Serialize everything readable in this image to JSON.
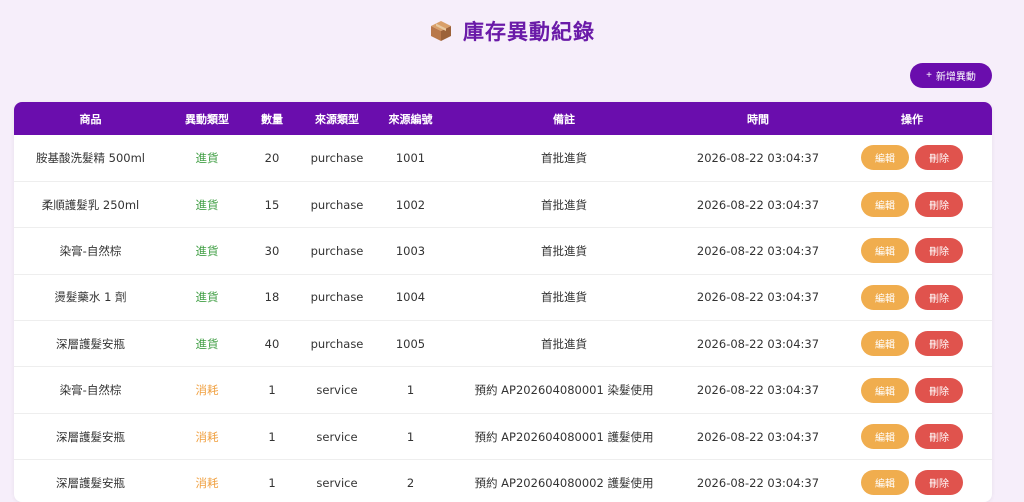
{
  "page": {
    "title": "庫存異動紀錄",
    "title_icon": "package-box-icon"
  },
  "toolbar": {
    "add_label": "新增異動",
    "add_icon": "+"
  },
  "table": {
    "headers": [
      "商品",
      "異動類型",
      "數量",
      "來源類型",
      "來源編號",
      "備註",
      "時間",
      "操作"
    ],
    "edit_label": "編輯",
    "delete_label": "刪除",
    "rows": [
      {
        "product": "胺基酸洗髮精 500ml",
        "type": "進貨",
        "qty": "20",
        "source_type": "purchase",
        "source_no": "1001",
        "note": "首批進貨",
        "time": "2026-08-22 03:04:37"
      },
      {
        "product": "柔順護髮乳 250ml",
        "type": "進貨",
        "qty": "15",
        "source_type": "purchase",
        "source_no": "1002",
        "note": "首批進貨",
        "time": "2026-08-22 03:04:37"
      },
      {
        "product": "染膏-自然棕",
        "type": "進貨",
        "qty": "30",
        "source_type": "purchase",
        "source_no": "1003",
        "note": "首批進貨",
        "time": "2026-08-22 03:04:37"
      },
      {
        "product": "燙髮藥水 1 劑",
        "type": "進貨",
        "qty": "18",
        "source_type": "purchase",
        "source_no": "1004",
        "note": "首批進貨",
        "time": "2026-08-22 03:04:37"
      },
      {
        "product": "深層護髮安瓶",
        "type": "進貨",
        "qty": "40",
        "source_type": "purchase",
        "source_no": "1005",
        "note": "首批進貨",
        "time": "2026-08-22 03:04:37"
      },
      {
        "product": "染膏-自然棕",
        "type": "消耗",
        "qty": "1",
        "source_type": "service",
        "source_no": "1",
        "note": "預約 AP202604080001 染髮使用",
        "time": "2026-08-22 03:04:37"
      },
      {
        "product": "深層護髮安瓶",
        "type": "消耗",
        "qty": "1",
        "source_type": "service",
        "source_no": "1",
        "note": "預約 AP202604080001 護髮使用",
        "time": "2026-08-22 03:04:37"
      },
      {
        "product": "深層護髮安瓶",
        "type": "消耗",
        "qty": "1",
        "source_type": "service",
        "source_no": "2",
        "note": "預約 AP202604080002 護髮使用",
        "time": "2026-08-22 03:04:37"
      }
    ]
  },
  "colors": {
    "brand": "#6a0dad",
    "background": "#f6eefa",
    "type_in": "#43a047",
    "type_out": "#f0a040",
    "edit": "#f0ad4e",
    "delete": "#e0534d"
  }
}
